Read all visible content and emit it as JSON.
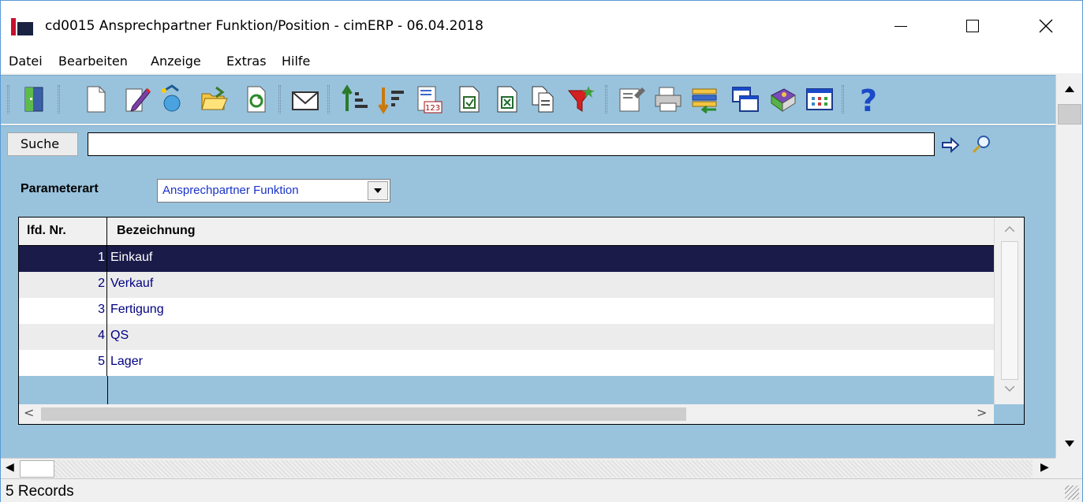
{
  "window": {
    "title": "cd0015 Ansprechpartner Funktion/Position - cimERP - 06.04.2018",
    "minimize_icon": "minimize-icon",
    "maximize_icon": "maximize-icon",
    "close_icon": "close-icon"
  },
  "menu": {
    "items": [
      {
        "label": "Datei"
      },
      {
        "label": "Bearbeiten"
      },
      {
        "label": "Anzeige"
      },
      {
        "label": "Extras"
      },
      {
        "label": "Hilfe"
      }
    ]
  },
  "toolbar": {
    "icons": [
      "exit-door-icon",
      "new-document-icon",
      "edit-pencil-icon",
      "copy-record-icon",
      "open-folder-icon",
      "refresh-icon",
      "email-icon",
      "sort-ascending-icon",
      "sort-descending-icon",
      "number-list-icon",
      "export-icon",
      "excel-export-icon",
      "copy-documents-icon",
      "filter-icon",
      "properties-icon",
      "print-icon",
      "import-icon",
      "windows-icon",
      "book-icon",
      "columns-icon",
      "help-icon"
    ]
  },
  "search": {
    "label": "Suche",
    "value": "",
    "placeholder": ""
  },
  "param": {
    "label": "Parameterart",
    "selected": "Ansprechpartner Funktion"
  },
  "grid": {
    "columns": [
      "lfd. Nr.",
      "Bezeichnung"
    ],
    "rows": [
      {
        "nr": "1",
        "bez": "Einkauf"
      },
      {
        "nr": "2",
        "bez": "Verkauf"
      },
      {
        "nr": "3",
        "bez": "Fertigung"
      },
      {
        "nr": "4",
        "bez": "QS"
      },
      {
        "nr": "5",
        "bez": "Lager"
      }
    ],
    "selected_index": 0
  },
  "status": {
    "text": "5 Records"
  },
  "colors": {
    "content_background": "#99c3dd",
    "selected_row": "#1b1b4a",
    "link_text": "#000080",
    "brand_red": "#c8102e"
  }
}
